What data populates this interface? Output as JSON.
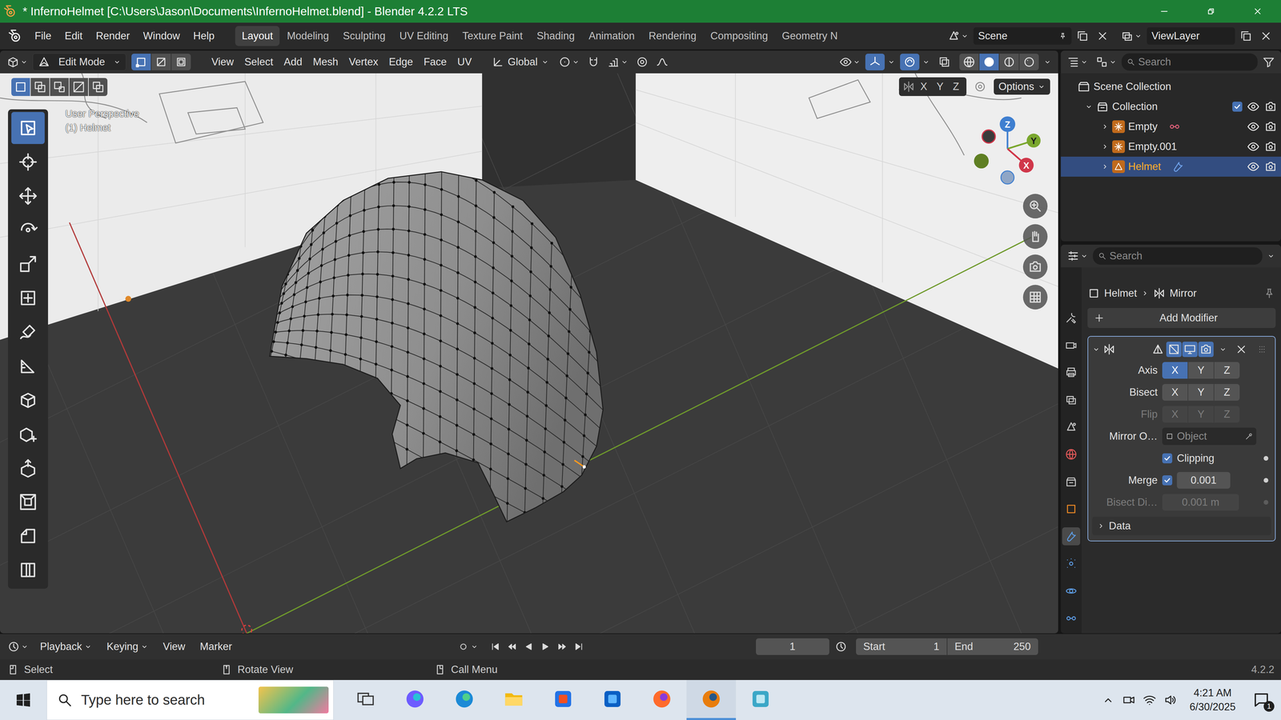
{
  "window": {
    "title": "* InfernoHelmet [C:\\Users\\Jason\\Documents\\InfernoHelmet.blend] - Blender 4.2.2 LTS"
  },
  "menu": [
    "File",
    "Edit",
    "Render",
    "Window",
    "Help"
  ],
  "workspaces": [
    {
      "label": "Layout",
      "selected": true
    },
    {
      "label": "Modeling",
      "selected": false
    },
    {
      "label": "Sculpting",
      "selected": false
    },
    {
      "label": "UV Editing",
      "selected": false
    },
    {
      "label": "Texture Paint",
      "selected": false
    },
    {
      "label": "Shading",
      "selected": false
    },
    {
      "label": "Animation",
      "selected": false
    },
    {
      "label": "Rendering",
      "selected": false
    },
    {
      "label": "Compositing",
      "selected": false
    },
    {
      "label": "Geometry N",
      "selected": false
    }
  ],
  "scene": "Scene",
  "view_layer": "ViewLayer",
  "viewport": {
    "mode": "Edit Mode",
    "select_modes": [
      {
        "kind": "vert-mode",
        "selected": true
      },
      {
        "kind": "edge-mode",
        "selected": false
      },
      {
        "kind": "face-mode",
        "selected": false
      }
    ],
    "menus": [
      "View",
      "Select",
      "Add",
      "Mesh",
      "Vertex",
      "Edge",
      "Face",
      "UV"
    ],
    "orientation": "Global",
    "gizmos_on": true,
    "overlays_on": true,
    "xray_on": false,
    "shading": [
      {
        "kind": "wireframe",
        "selected": false
      },
      {
        "kind": "solid",
        "selected": true
      },
      {
        "kind": "material",
        "selected": false
      },
      {
        "kind": "rendered",
        "selected": false
      }
    ],
    "box_modes": [
      {
        "kind": "sel-set",
        "selected": true
      },
      {
        "kind": "sel-extend",
        "selected": false
      },
      {
        "kind": "sel-sub",
        "selected": false
      },
      {
        "kind": "sel-invert",
        "selected": false
      },
      {
        "kind": "sel-intersect",
        "selected": false
      }
    ],
    "symmetry": [
      {
        "label": "X",
        "on": false
      },
      {
        "label": "Y",
        "on": false
      },
      {
        "label": "Z",
        "on": false
      }
    ],
    "options": "Options",
    "overlay_text": [
      "User Perspective",
      "(1) Helmet"
    ],
    "gizmo": {
      "z": "Z",
      "y": "Y",
      "x": "X"
    },
    "tools": [
      {
        "kind": "select",
        "selected": true
      },
      {
        "kind": "cursor",
        "selected": false
      },
      {
        "kind": "move",
        "selected": false
      },
      {
        "kind": "rotate",
        "selected": false
      },
      {
        "kind": "scale",
        "selected": false
      },
      {
        "kind": "transform",
        "selected": false
      },
      {
        "kind": "annotate",
        "selected": false
      },
      {
        "kind": "measure",
        "selected": false
      },
      {
        "kind": "add-cube",
        "selected": false
      },
      {
        "kind": "add-cursor",
        "selected": false
      },
      {
        "kind": "extrude",
        "selected": false
      },
      {
        "kind": "inset",
        "selected": false
      },
      {
        "kind": "bevel",
        "selected": false
      },
      {
        "kind": "loop-cut",
        "selected": false
      }
    ]
  },
  "outliner": {
    "search": "Search",
    "scene_collection": "Scene Collection",
    "collection": {
      "label": "Collection",
      "expanded": true,
      "checked": true,
      "visible": true,
      "renderable": true
    },
    "objects": [
      {
        "label": "Empty",
        "kind": "empty",
        "selected": false,
        "expanded": false,
        "has_constraint": true,
        "has_modifier": false,
        "visible": true,
        "renderable": true
      },
      {
        "label": "Empty.001",
        "kind": "empty",
        "selected": false,
        "expanded": false,
        "has_constraint": false,
        "has_modifier": false,
        "visible": true,
        "renderable": true
      },
      {
        "label": "Helmet",
        "kind": "mesh",
        "selected": true,
        "expanded": false,
        "has_constraint": false,
        "has_modifier": true,
        "visible": true,
        "renderable": true
      }
    ]
  },
  "properties": {
    "search": "Search",
    "tabs": [
      {
        "kind": "tool",
        "selected": false
      },
      {
        "kind": "render",
        "selected": false
      },
      {
        "kind": "output",
        "selected": false
      },
      {
        "kind": "view-layer",
        "selected": false
      },
      {
        "kind": "scene",
        "selected": false
      },
      {
        "kind": "world",
        "selected": false
      },
      {
        "kind": "collection",
        "selected": false
      },
      {
        "kind": "object",
        "selected": false
      },
      {
        "kind": "modifier",
        "selected": true
      },
      {
        "kind": "particles",
        "selected": false
      },
      {
        "kind": "physics",
        "selected": false
      },
      {
        "kind": "constraints",
        "selected": false
      },
      {
        "kind": "data",
        "selected": false
      }
    ],
    "breadcrumb": [
      "Helmet",
      "Mirror"
    ],
    "add_modifier": "Add Modifier",
    "modifier": {
      "expanded": true,
      "active": true,
      "toggles": [
        {
          "kind": "on-cage",
          "on": false
        },
        {
          "kind": "edit-mode",
          "on": true
        },
        {
          "kind": "viewport",
          "on": true
        },
        {
          "kind": "render-cam",
          "on": true
        }
      ],
      "axis": {
        "label": "Axis",
        "options": [
          {
            "label": "X",
            "on": true
          },
          {
            "label": "Y",
            "on": false
          },
          {
            "label": "Z",
            "on": false
          }
        ]
      },
      "bisect": {
        "label": "Bisect",
        "options": [
          {
            "label": "X",
            "on": false
          },
          {
            "label": "Y",
            "on": false
          },
          {
            "label": "Z",
            "on": false
          }
        ]
      },
      "flip": {
        "label": "Flip",
        "disabled": true,
        "options": [
          {
            "label": "X",
            "on": false
          },
          {
            "label": "Y",
            "on": false
          },
          {
            "label": "Z",
            "on": false
          }
        ]
      },
      "mirror_object": {
        "label": "Mirror O…",
        "placeholder": "Object"
      },
      "clipping": {
        "label": "Clipping",
        "checked": true
      },
      "merge": {
        "label": "Merge",
        "checked": true,
        "value": "0.001"
      },
      "bisect_distance": {
        "label": "Bisect Di…",
        "value": "0.001 m",
        "disabled": true
      },
      "data": {
        "label": "Data",
        "expanded": false
      }
    }
  },
  "timeline": {
    "menus": [
      {
        "label": "Playback",
        "dropdown": true
      },
      {
        "label": "Keying",
        "dropdown": true
      },
      {
        "label": "View",
        "dropdown": false
      },
      {
        "label": "Marker",
        "dropdown": false
      }
    ],
    "frame": "1",
    "start_label": "Start",
    "start": "1",
    "end_label": "End",
    "end": "250"
  },
  "status": {
    "hints": [
      "Select",
      "Rotate View",
      "Call Menu"
    ],
    "version": "4.2.2"
  },
  "taskbar": {
    "search": "Type here to search",
    "apps": [
      {
        "kind": "task-view",
        "active": false
      },
      {
        "kind": "copilot",
        "active": false
      },
      {
        "kind": "edge",
        "active": false
      },
      {
        "kind": "explorer",
        "active": false
      },
      {
        "kind": "store",
        "active": false
      },
      {
        "kind": "outlook",
        "active": false
      },
      {
        "kind": "firefox",
        "active": false
      },
      {
        "kind": "blender",
        "active": true
      },
      {
        "kind": "notes",
        "active": false
      }
    ],
    "time": "4:21 AM",
    "date": "6/30/2025",
    "notifications": "1"
  }
}
